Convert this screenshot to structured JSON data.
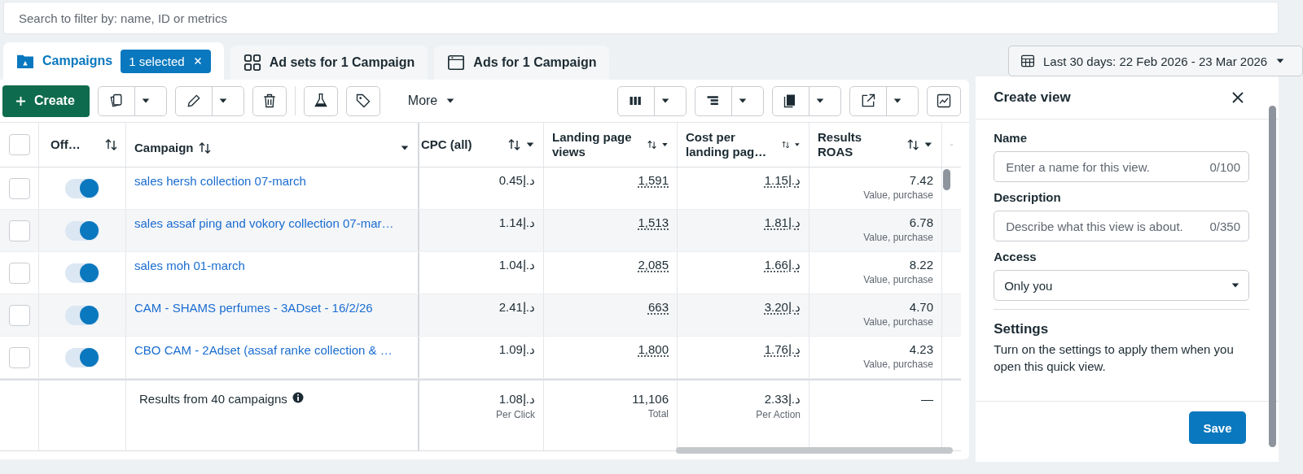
{
  "search": {
    "placeholder": "Search to filter by: name, ID or metrics"
  },
  "tabs": [
    {
      "label": "Campaigns",
      "kind": "folder",
      "selected": true,
      "badge": "1 selected"
    },
    {
      "label": "Ad sets for 1 Campaign",
      "kind": "grid",
      "selected": false
    },
    {
      "label": "Ads for 1 Campaign",
      "kind": "window",
      "selected": false
    }
  ],
  "date_range": "Last 30 days: 22 Feb 2026 - 23 Mar 2026",
  "toolbar": {
    "create": "Create",
    "more": "More"
  },
  "table": {
    "select_all": {
      "checked": false
    },
    "columns": [
      "Off…",
      "Campaign",
      "CPC (all)",
      "Landing page views",
      "Cost per landing pag…",
      "Results ROAS"
    ],
    "rows": [
      {
        "checked": false,
        "on": true,
        "campaign": "sales hersh collection 07-march",
        "cpc": "0.45د.إ",
        "landing_views": "1,591",
        "cost_per_landing": "1.15د.إ",
        "results": "7.42",
        "results_note": "Value, purchase"
      },
      {
        "checked": false,
        "on": true,
        "campaign": "sales assaf ping and vokory collection 07-mar…",
        "cpc": "1.14د.إ",
        "landing_views": "1,513",
        "cost_per_landing": "1.81د.إ",
        "results": "6.78",
        "results_note": "Value, purchase"
      },
      {
        "checked": false,
        "on": true,
        "campaign": "sales moh 01-march",
        "cpc": "1.04د.إ",
        "landing_views": "2,085",
        "cost_per_landing": "1.66د.إ",
        "results": "8.22",
        "results_note": "Value, purchase"
      },
      {
        "checked": false,
        "on": true,
        "campaign": "CAM - SHAMS perfumes - 3ADset - 16/2/26",
        "cpc": "2.41د.إ",
        "landing_views": "663",
        "cost_per_landing": "3.20د.إ",
        "results": "4.70",
        "results_note": "Value, purchase"
      },
      {
        "checked": false,
        "on": true,
        "campaign": "CBO CAM - 2Adset (assaf ranke collection & …",
        "cpc": "1.09د.إ",
        "landing_views": "1,800",
        "cost_per_landing": "1.76د.إ",
        "results": "4.23",
        "results_note": "Value, purchase"
      }
    ],
    "footer": {
      "label": "Results from 40 campaigns",
      "cpc": "1.08د.إ",
      "cpc_note": "Per Click",
      "landing_views": "11,106",
      "landing_note": "Total",
      "cost_per_landing": "2.33د.إ",
      "cost_note": "Per Action",
      "results": "—"
    }
  },
  "panel": {
    "title": "Create view",
    "name": {
      "label": "Name",
      "placeholder": "Enter a name for this view.",
      "counter": "0/100"
    },
    "description": {
      "label": "Description",
      "placeholder": "Describe what this view is about.",
      "counter": "0/350"
    },
    "access": {
      "label": "Access",
      "value": "Only you"
    },
    "settings": {
      "heading": "Settings",
      "text": "Turn on the settings to apply them when you open this quick view."
    },
    "save": "Save"
  }
}
